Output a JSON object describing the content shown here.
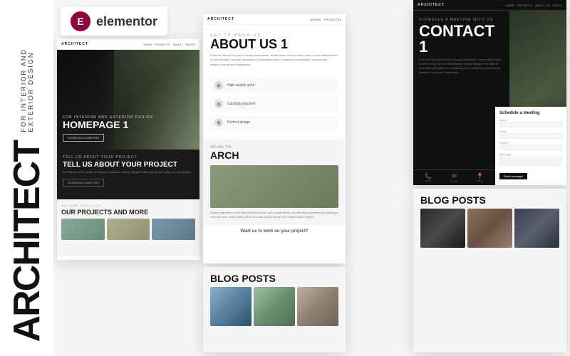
{
  "sidebar": {
    "tagline": "FOR INTERIOR AND EXTERIOR DESIGN",
    "brand": "ARCHITECT"
  },
  "elementor_badge": {
    "label": "elementor",
    "icon": "E"
  },
  "panel_homepage": {
    "nav_logo": "ARCHITECT",
    "nav_links": [
      "HOME",
      "PROJECTS",
      "ABOUT US",
      "PAGES"
    ],
    "hero_subtitle": "FOR INTERIOR AND EXTERIOR DESIGN",
    "hero_title": "HOMEPAGE 1",
    "hero_btn": "SCHEDULE A MEETING",
    "project_label": "TELL US ABOUT YOUR PROJECT",
    "project_heading": "TELL US ABOUT YOUR PROJECT",
    "project_text": "We believe in the power of beauty and stories. Interior design invites you to put a story on your space, an embodiment of your lifestyle. We offer a comprehensive that combines architectural mastery, luxury and uniqueness.",
    "project_btn": "SCHEDULE A MEETING",
    "strip_label": "ALL OUR PROJECTS",
    "strip_title": "OUR PROJECTS AND MORE"
  },
  "panel_about": {
    "nav_logo": "ARCHITECT",
    "nav_links": [
      "HOME ▸",
      "PROJECTS ▸"
    ],
    "about_label": "GET TO KNOW US",
    "about_title": "ABOUT US 1",
    "about_text": "From the idea to the point of luxury expression, where each home is both a main, but an embodiment of your lifestyle, we have specialized in everything that is related to architecture, architectural mastery, luxury and uniqueness.",
    "features": [
      {
        "icon": "◎",
        "text": "High-quality work"
      },
      {
        "icon": "◎",
        "text": "Carefully planned"
      },
      {
        "icon": "◎",
        "text": "Perfect design"
      }
    ],
    "arch_label": "WE ARE THE",
    "arch_title": "ARCH",
    "arch_text": "Duplex that refers to the fact that there is two and a multi-family unit with two properties that sharing a common wall, where each unit is on a one-storey house of a medium-sized project.",
    "cta": "Want us to work on your project?"
  },
  "panel_contact": {
    "nav_logo": "ARCHITECT",
    "nav_links": [
      "HOME ▸",
      "PROJECTS ▸",
      "ABOUT US ▸",
      "PAGES ▸"
    ],
    "contact_label": "SCHEDULE A MEETING WITH US",
    "contact_title": "CONTACT 1",
    "contact_text": "From the idea to the birth of luxury expression, where each home is both a main, but an embodiment of your lifestyle. We have a team with specialized in everything that is related to architectural mastery, luxury and uniqueness.",
    "form_title": "Schedule a meeting",
    "form_fields": [
      {
        "label": "Name",
        "placeholder": ""
      },
      {
        "label": "Email",
        "placeholder": ""
      },
      {
        "label": "Subject",
        "placeholder": ""
      },
      {
        "label": "Message",
        "placeholder": ""
      }
    ],
    "form_btn": "Send message",
    "footer_items": [
      {
        "icon": "📞",
        "text": "Call Us\n+1 (56 587550)"
      },
      {
        "icon": "✉",
        "text": "Emails\narchitect@gmail.com"
      },
      {
        "icon": "📍",
        "text": "Visit our studio\n#34 Ave Av 5556"
      }
    ]
  },
  "panel_blog1": {
    "label": "BLOG POSTS",
    "title": "BLOG POSTS"
  },
  "panel_blog2": {
    "label": "BLOG POSTS",
    "title": "BLOG POSTS"
  },
  "colors": {
    "bg": "#f5f5f5",
    "dark": "#111111",
    "white": "#ffffff",
    "accent": "#92003B"
  }
}
